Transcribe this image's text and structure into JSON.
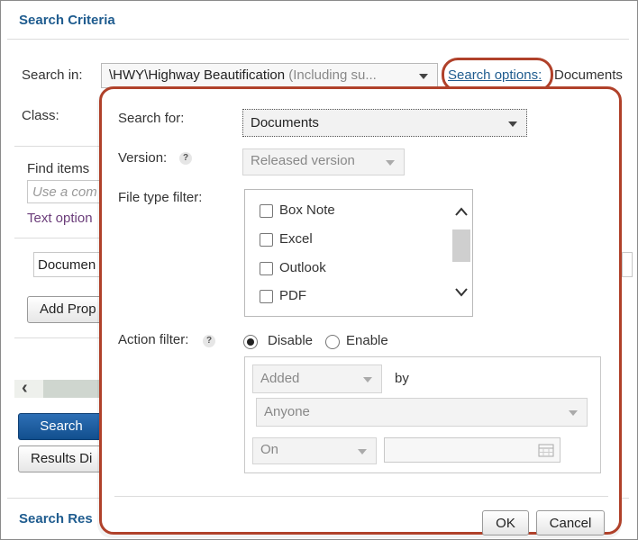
{
  "background": {
    "search_criteria_title": "Search Criteria",
    "search_in_label": "Search in:",
    "search_in_path": "\\HWY\\Highway Beautification",
    "search_in_suffix": "(Including su...",
    "search_options_link": "Search options:",
    "search_options_value": "Documents",
    "class_label": "Class:",
    "find_items_label": "Find items",
    "find_placeholder": "Use a com",
    "text_options_link": "Text option",
    "documents_field": "Documen",
    "add_property_button": "Add Prop",
    "search_button": "Search",
    "results_display_button": "Results Di",
    "search_results_title": "Search Res"
  },
  "dialog": {
    "search_for_label": "Search for:",
    "search_for_value": "Documents",
    "version_label": "Version:",
    "version_value": "Released version",
    "file_type_label": "File type filter:",
    "file_types": [
      "Box Note",
      "Excel",
      "Outlook",
      "PDF"
    ],
    "action_filter_label": "Action filter:",
    "disable_label": "Disable",
    "enable_label": "Enable",
    "action_value": "Added",
    "by_label": "by",
    "user_value": "Anyone",
    "date_op_value": "On",
    "ok_button": "OK",
    "cancel_button": "Cancel"
  },
  "colors": {
    "accent": "#1f5c8f",
    "highlight": "#b0412a",
    "primary_button": "#124f8e"
  }
}
